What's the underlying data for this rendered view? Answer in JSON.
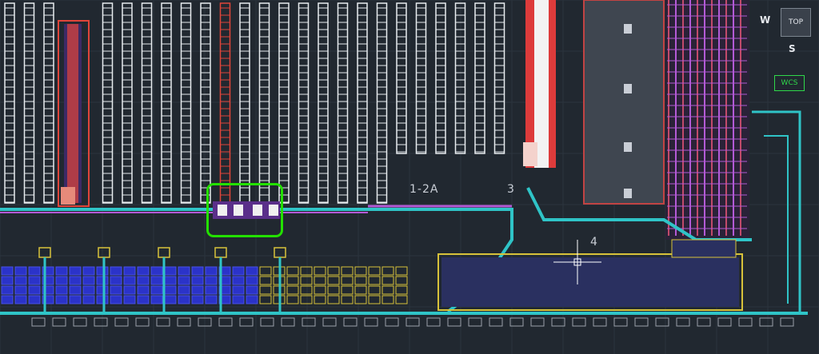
{
  "zones": {
    "zone_1_2a": "1-2A",
    "zone_3": "3",
    "zone_4": "4"
  },
  "viewcube": {
    "top_label": "TOP",
    "west_label": "W",
    "south_label": "S",
    "wcs_label": "WCS"
  },
  "colors": {
    "background": "#212830",
    "rack_white": "#e8ecef",
    "rack_red": "#e0453a",
    "conveyor_cyan": "#2fc4c7",
    "conveyor_purple": "#b35ad6",
    "pallet_blue": "#2b33c9",
    "highlight_green": "#23e000",
    "yellow_outline": "#d8c23a"
  }
}
